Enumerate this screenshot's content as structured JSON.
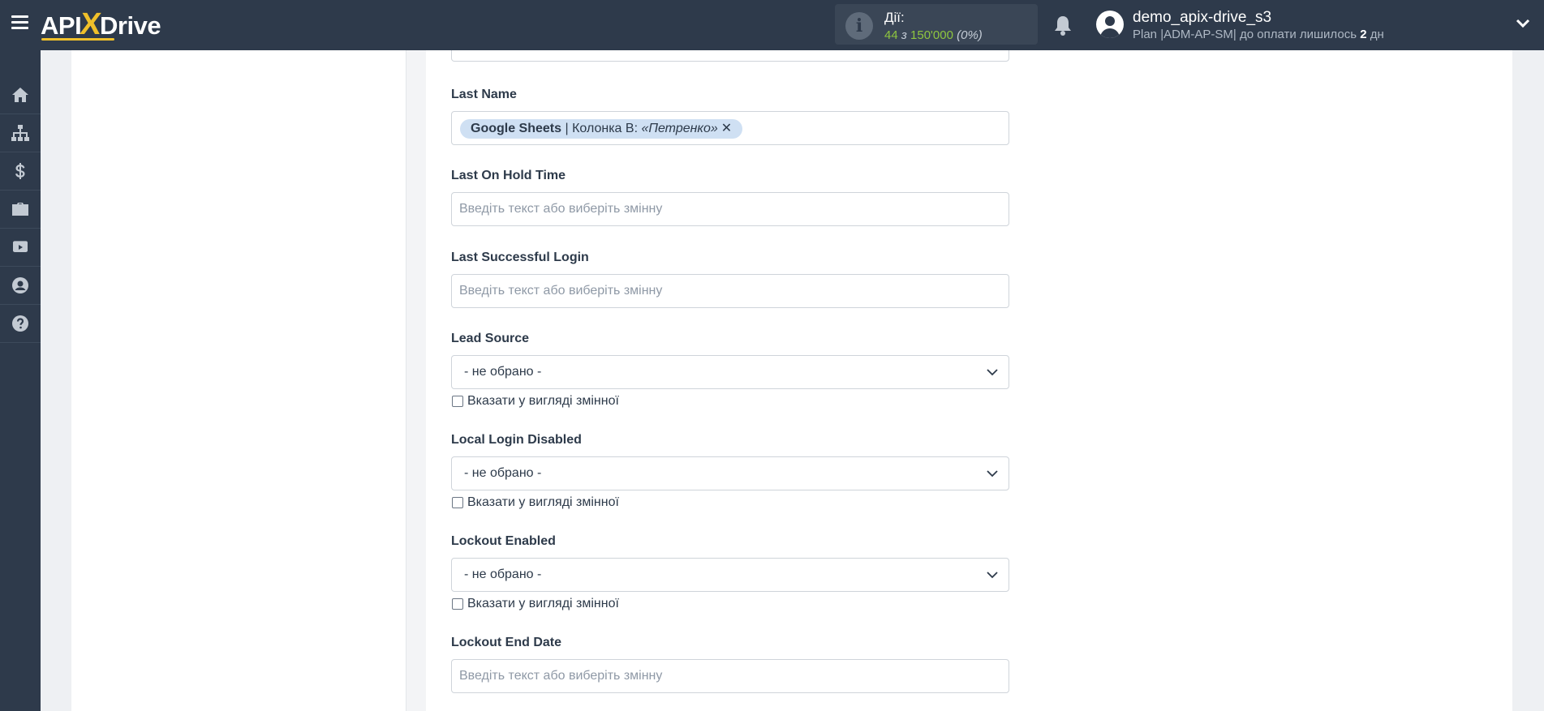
{
  "header": {
    "logo_pre": "API",
    "logo_x": "X",
    "logo_post": "Drive",
    "actions_label": "Дії:",
    "actions_count": "44",
    "actions_of": "з",
    "actions_total": "150'000",
    "actions_pct": "(0%)",
    "username": "demo_apix-drive_s3",
    "plan_text": "Plan |ADM-AP-SM| до оплати лишилось",
    "plan_days": "2",
    "plan_unit": "дн"
  },
  "sidebar": {
    "items": [
      {
        "icon": "home-icon"
      },
      {
        "icon": "sitemap-icon"
      },
      {
        "icon": "dollar-icon"
      },
      {
        "icon": "briefcase-icon"
      },
      {
        "icon": "youtube-icon"
      },
      {
        "icon": "user-circle-icon"
      },
      {
        "icon": "help-circle-icon"
      }
    ]
  },
  "form": {
    "last_name": {
      "label": "Last Name",
      "tag_source": "Google Sheets",
      "tag_sep": " | Колонка B: ",
      "tag_value": "«Петренко»",
      "tag_remove": "✕"
    },
    "last_on_hold_time": {
      "label": "Last On Hold Time",
      "placeholder": "Введіть текст або виберіть змінну"
    },
    "last_successful_login": {
      "label": "Last Successful Login",
      "placeholder": "Введіть текст або виберіть змінну"
    },
    "lead_source": {
      "label": "Lead Source",
      "selected": "- не обрано -",
      "checkbox_label": "Вказати у вигляді змінної"
    },
    "local_login_disabled": {
      "label": "Local Login Disabled",
      "selected": "- не обрано -",
      "checkbox_label": "Вказати у вигляді змінної"
    },
    "lockout_enabled": {
      "label": "Lockout Enabled",
      "selected": "- не обрано -",
      "checkbox_label": "Вказати у вигляді змінної"
    },
    "lockout_end_date": {
      "label": "Lockout End Date",
      "placeholder": "Введіть текст або виберіть змінну"
    }
  },
  "colors": {
    "topbar": "#2e3a4b",
    "accent_yellow": "#f0c02a",
    "count_green": "#8fc63f",
    "tag_bg": "#cfe0f3"
  }
}
